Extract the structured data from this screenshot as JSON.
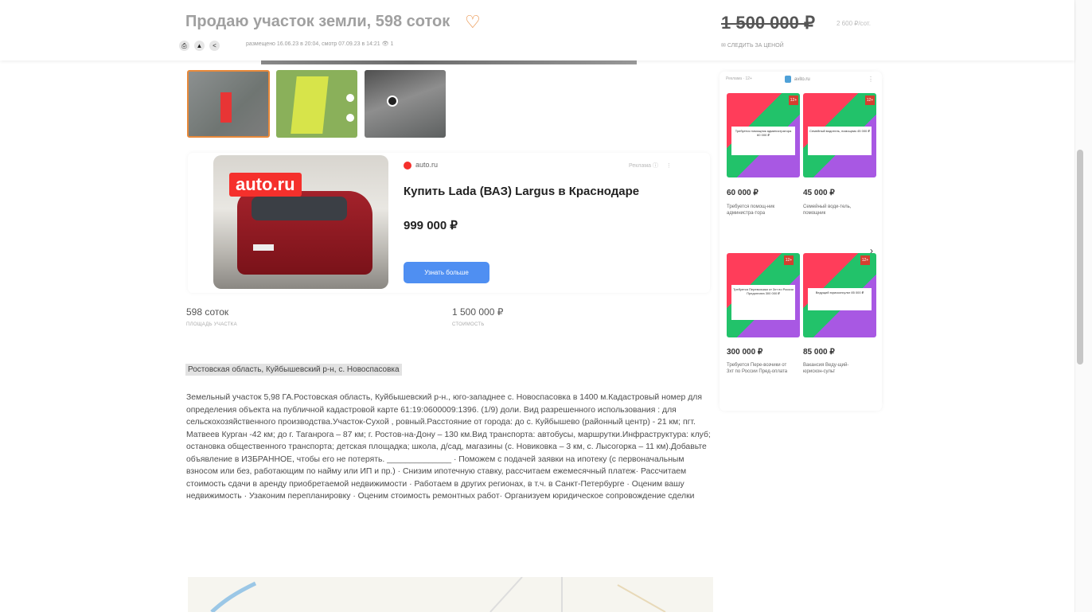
{
  "header": {
    "title": "Продаю участок земли, 598 соток",
    "meta": "размещено 16.06.23 в 20:04, смотр 07.09.23 в 14:21",
    "views": "1",
    "price": "1 500 000 ₽",
    "price_per": "2 600 ₽/сот.",
    "follow_label": "СЛЕДИТЬ ЗА ЦЕНОЙ"
  },
  "ad": {
    "logo_text": "auto.ru",
    "source": "auto.ru",
    "label": "Реклама",
    "title": "Купить Lada (ВАЗ) Largus в Краснодаре",
    "price": "999 000 ₽",
    "button": "Узнать больше"
  },
  "params": [
    {
      "value": "598 соток",
      "label": "ПЛОЩАДЬ УЧАСТКА"
    },
    {
      "value": "1 500 000 ₽",
      "label": "СТОИМОСТЬ"
    }
  ],
  "address": "Ростовская область, Куйбышевский р-н, с. Новоспасовка",
  "description": "Земельный участок 5,98 ГА.Ростовская область, Куйбышевский р-н., юго-западнее с. Новоспасовка в 1400 м.Кадастровый номер для определения объекта на публичной кадастровой карте 61:19:0600009:1396. (1/9) доли. Вид разрешенного использования : для сельскохозяйственного производства.Участок-Сухой , ровный.Расстояние от города: до с. Куйбышево (районный центр) - 21 км; пгт. Матвеев Курган -42 км; до г. Таганрога – 87 км; г. Ростов-на-Дону – 130 км.Вид транспорта: автобусы, маршрутки.Инфраструктура: клуб; остановка общественного транспорта; детская площадка; школа, д/сад, магазины (с. Новиковка – 3 км, с. Лысогорка – 11 км).Добавьте объявление в ИЗБРАННОЕ, чтобы его не потерять. ______________ · Поможем с подачей заявки на ипотеку (с первоначальным взносом или без, работающим по найму или ИП и пр.) · Снизим ипотечную ставку, рассчитаем ежемесячный платеж· Рассчитаем стоимость сдачи в аренду приобретаемой недвижимости · Работаем в других регионах, в т.ч. в Санкт-Петербурге · Оценим вашу недвижимость · Узаконим перепланировку · Оценим стоимость ремонтных работ· Организуем юридическое сопровождение сделки",
  "feed": {
    "top_label": "Реклама · 12+",
    "source": "avito.ru",
    "cards": [
      {
        "price": "60 000 ₽",
        "desc": "Требуется помощ-ник администра-тора",
        "box": "Требуется помощник администратора 60 000 ₽",
        "badge": "12+"
      },
      {
        "price": "45 000 ₽",
        "desc": "Семейный води-тель, помощник",
        "box": "Семейный водитель, помощник 45 000 ₽",
        "badge": "12+"
      },
      {
        "price": "300 000 ₽",
        "desc": "Требуется Пере-возчики от 3хт по России Пред-оплата",
        "box": "Требуется Перевозчики от 3хт по России Предоплата 300 000 ₽",
        "badge": "12+"
      },
      {
        "price": "85 000 ₽",
        "desc": "Вакансия Веду-щий-юрискон-сульт",
        "box": "Ведущий юрисконсульт 85 000 ₽",
        "badge": "12+"
      }
    ]
  }
}
